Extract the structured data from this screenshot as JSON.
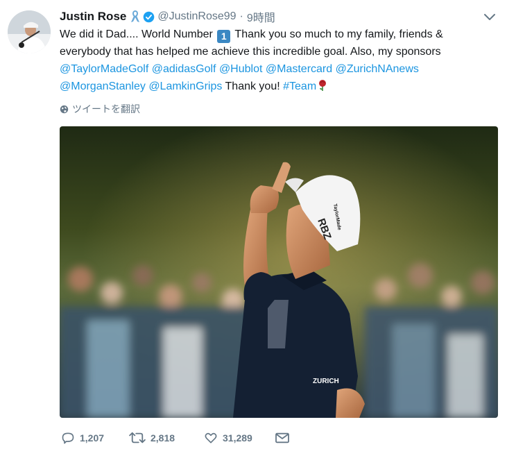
{
  "tweet": {
    "display_name": "Justin Rose",
    "handle": "@JustinRose99",
    "dot": "·",
    "time_ago": "9時間",
    "text": {
      "line1_pre": "We did it Dad.... World Number ",
      "keycap": "1",
      "line1_post": " Thank you so much to my family, friends &",
      "line2": "everybody that has helped me achieve this incredible goal. Also, my sponsors",
      "mentions_line3": [
        "@TaylorMadeGolf",
        "@adidasGolf",
        "@Hublot",
        "@Mastercard",
        "@ZurichNAnews"
      ],
      "mentions_line4": [
        "@MorganStanley",
        "@LamkinGrips"
      ],
      "thanks": "Thank you!",
      "hashtag": "#Team"
    },
    "translate_label": "ツイートを翻訳",
    "counts": {
      "replies": "1,207",
      "retweets": "2,818",
      "likes": "31,289"
    },
    "photo": {
      "cap_logo": "RBZ",
      "cap_brand": "TaylorMade",
      "shirt_logo": "ZURICH"
    }
  },
  "colors": {
    "link": "#1b95e0",
    "secondary": "#657786",
    "verified": "#1da1f2",
    "keycap": "#3b88c3"
  }
}
